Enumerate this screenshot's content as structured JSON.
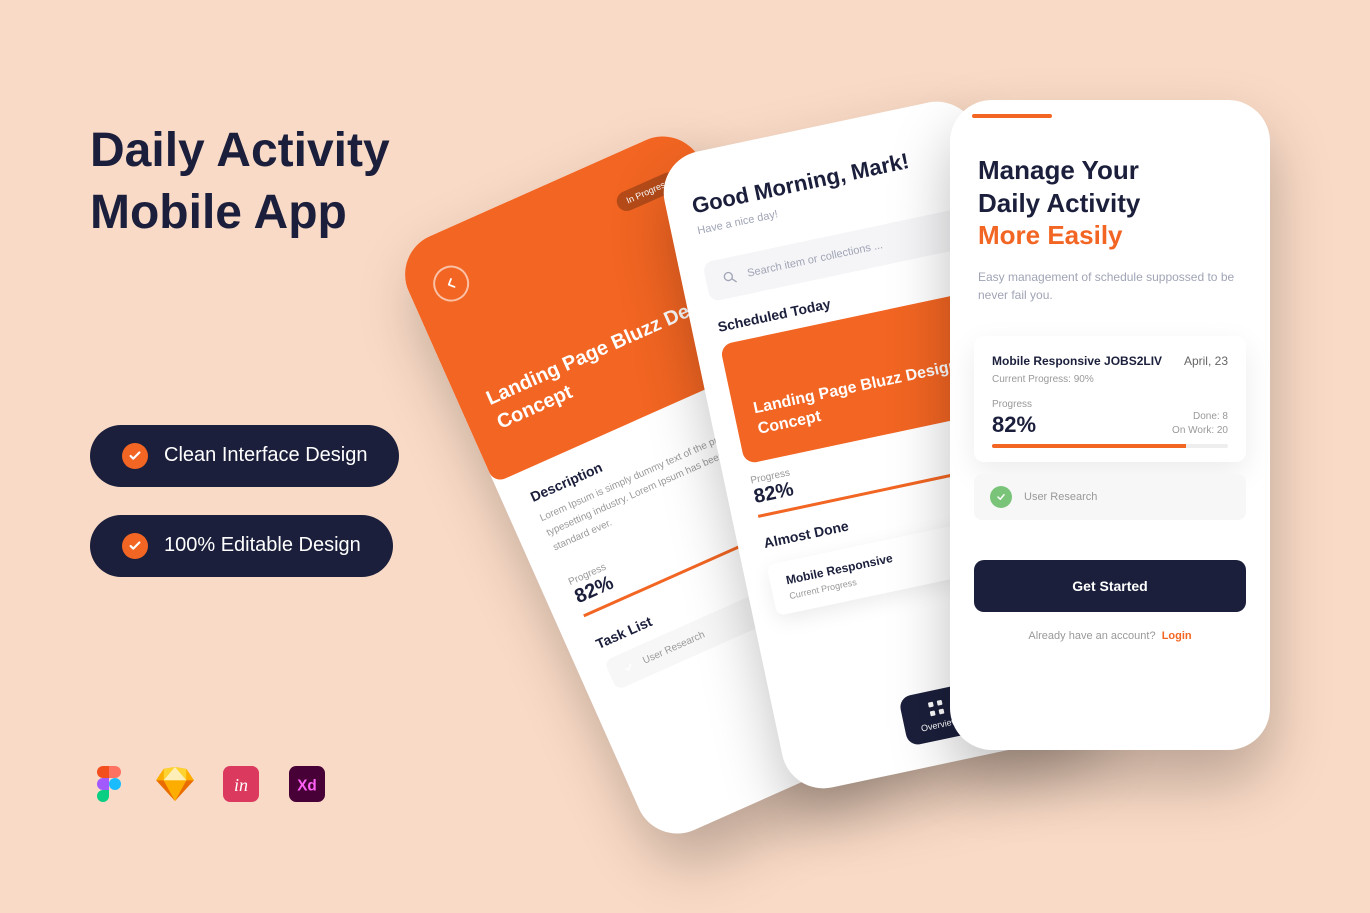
{
  "promo": {
    "title_line1": "Daily Activity",
    "title_line2": "Mobile App",
    "feature1": "Clean Interface Design",
    "feature2": "100% Editable Design",
    "tools": [
      "Figma",
      "Sketch",
      "InVision",
      "Adobe XD"
    ]
  },
  "phone1": {
    "badge": "In Progress",
    "header_title": "Landing Page Bluzz Design Concept",
    "section_desc_label": "Description",
    "section_desc_body": "Lorem Ipsum is simply dummy text of the printing and typesetting industry. Lorem Ipsum has been the industry's standard ever.",
    "progress_label": "Progress",
    "progress_value": "82%",
    "task_list_label": "Task List",
    "task1": "User Research"
  },
  "phone2": {
    "greeting": "Good Morning, Mark!",
    "subgreet": "Have a nice day!",
    "search_placeholder": "Search item or collections ...",
    "section1": "Scheduled Today",
    "card_title": "Landing Page Bluzz Design Concept",
    "progress_label": "Progress",
    "progress_value": "82%",
    "section2": "Almost Done",
    "card2_title": "Mobile Responsive",
    "card2_sub": "Current Progress",
    "nav_label": "Overview"
  },
  "phone3": {
    "hero_line1": "Manage Your",
    "hero_line2": "Daily Activity",
    "hero_line3": "More Easily",
    "hero_sub": "Easy management of schedule suppossed to be never fail you.",
    "card": {
      "title": "Mobile Responsive JOBS2LIV",
      "date": "April, 23",
      "current": "Current Progress: 90%",
      "progress_label": "Progress",
      "progress_value": "82%",
      "done": "Done: 8",
      "onwork": "On Work: 20"
    },
    "task1": "User Research",
    "cta": "Get Started",
    "footer_text": "Already have an account?",
    "footer_link": "Login"
  }
}
